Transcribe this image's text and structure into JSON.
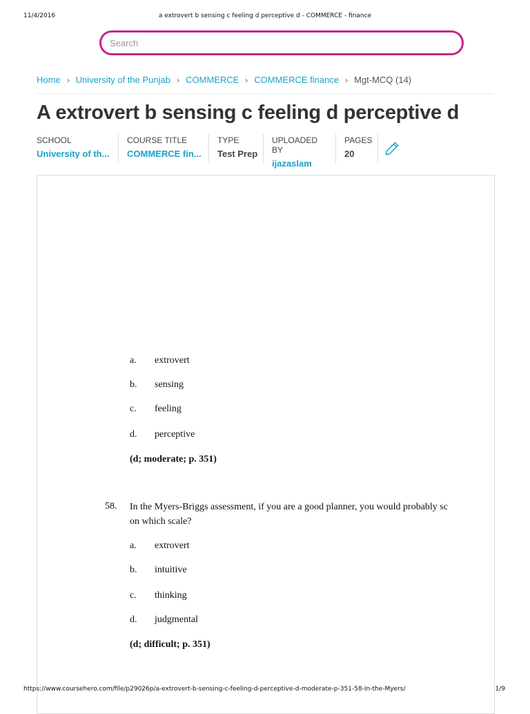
{
  "print_header": {
    "date": "11/4/2016",
    "title": "a extrovert b sensing c feeling d perceptive d - COMMERCE - finance"
  },
  "search": {
    "placeholder": "Search"
  },
  "breadcrumb": {
    "items": [
      "Home",
      "University of the Punjab",
      "COMMERCE",
      "COMMERCE finance"
    ],
    "current": "Mgt-MCQ (14)"
  },
  "page_title": "A extrovert b sensing c feeling d perceptive d",
  "meta": {
    "school_label": "SCHOOL",
    "school_value": "University of th...",
    "course_label": "COURSE TITLE",
    "course_value": "COMMERCE fin...",
    "type_label": "TYPE",
    "type_value": "Test Prep",
    "uploader_label": "UPLOADED BY",
    "uploader_value": "ijazaslam",
    "pages_label": "PAGES",
    "pages_value": "20"
  },
  "document": {
    "q57": {
      "options": [
        {
          "letter": "a.",
          "text": "extrovert"
        },
        {
          "letter": "b.",
          "text": "sensing"
        },
        {
          "letter": "c.",
          "text": "feeling"
        },
        {
          "letter": "d.",
          "text": "perceptive"
        }
      ],
      "answer": "(d; moderate; p. 351)"
    },
    "q58": {
      "number": "58.",
      "text_line1": "In the Myers-Briggs assessment, if you are a good planner, you would probably sc",
      "text_line2": "on which scale?",
      "options": [
        {
          "letter": "a.",
          "text": "extrovert"
        },
        {
          "letter": "b.",
          "text": "intuitive"
        },
        {
          "letter": "c.",
          "text": "thinking"
        },
        {
          "letter": "d.",
          "text": "judgmental"
        }
      ],
      "answer": "(d; difficult; p. 351)"
    }
  },
  "print_footer": {
    "url": "https://www.coursehero.com/file/p29026p/a-extrovert-b-sensing-c-feeling-d-perceptive-d-moderate-p-351-58-In-the-Myers/",
    "page": "1/9"
  },
  "colors": {
    "accent": "#1aa3c7",
    "search_border": "#c8248c"
  },
  "icons": {
    "edit": "pencil-icon",
    "breadcrumb_separator": "chevron-right-icon"
  }
}
